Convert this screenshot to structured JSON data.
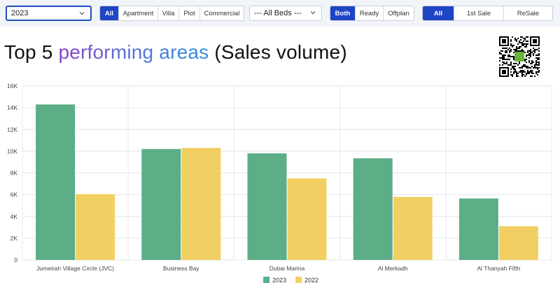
{
  "filters": {
    "year": {
      "value": "2023"
    },
    "property_type": {
      "options": [
        "All",
        "Apartment",
        "Villa",
        "Plot",
        "Commercial"
      ],
      "selected": "All"
    },
    "beds": {
      "value": "--- All Beds ---"
    },
    "status": {
      "options": [
        "Both",
        "Ready",
        "Offplan"
      ],
      "selected": "Both"
    },
    "sale_type": {
      "options": [
        "All",
        "1st Sale",
        "ReSale"
      ],
      "selected": "All"
    }
  },
  "headline": {
    "part1": "Top 5 ",
    "highlight": "performing areas",
    "part2": " (Sales volume)"
  },
  "icons": {
    "dropdown": "chevron-down-icon",
    "qr": "qr-code-icon"
  },
  "colors": {
    "accent": "#1e45c6",
    "series_2023": "#5bae86",
    "series_2022": "#f2cf63"
  },
  "chart_data": {
    "type": "bar",
    "categories": [
      "Jumeirah Village Circle (JVC)",
      "Business Bay",
      "Dubai Marina",
      "Al Merkadh",
      "Al Thanyah Fifth"
    ],
    "series": [
      {
        "name": "2023",
        "values": [
          14300,
          10200,
          9800,
          9350,
          5650
        ]
      },
      {
        "name": "2022",
        "values": [
          6050,
          10300,
          7500,
          5800,
          3100
        ]
      }
    ],
    "ylim": [
      0,
      16000
    ],
    "yticks": [
      "0",
      "2K",
      "4K",
      "6K",
      "8K",
      "10K",
      "12K",
      "14K",
      "16K"
    ],
    "grid": true,
    "legend_position": "bottom-center"
  }
}
